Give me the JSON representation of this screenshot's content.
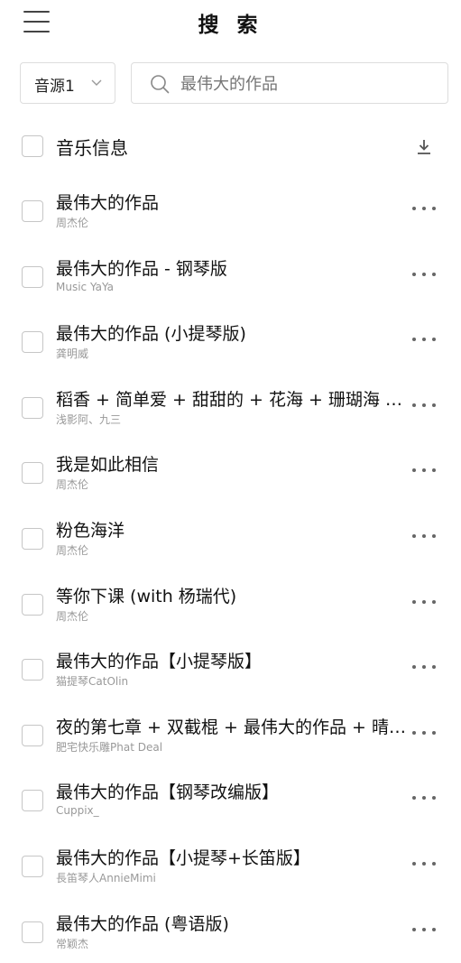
{
  "header": {
    "title": "搜 索",
    "menu_icon": "hamburger-menu-icon"
  },
  "search": {
    "source_label": "音源1",
    "placeholder": "最伟大的作品",
    "value": ""
  },
  "list_header": {
    "label": "音乐信息",
    "action_icon": "download-icon"
  },
  "songs": [
    {
      "title": "最伟大的作品",
      "artist": "周杰伦"
    },
    {
      "title": "最伟大的作品 - 钢琴版",
      "artist": "Music YaYa"
    },
    {
      "title": "最伟大的作品 (小提琴版)",
      "artist": "龚明威"
    },
    {
      "title": "稻香 + 简单爱 + 甜甜的 + 花海 + 珊瑚海 + …",
      "artist": "浅影阿、九三"
    },
    {
      "title": "我是如此相信",
      "artist": "周杰伦"
    },
    {
      "title": "粉色海洋",
      "artist": "周杰伦"
    },
    {
      "title": "等你下课 (with 杨瑞代)",
      "artist": "周杰伦"
    },
    {
      "title": "最伟大的作品【小提琴版】",
      "artist": "猫提琴CatOlin"
    },
    {
      "title": "夜的第七章 + 双截棍 + 最伟大的作品 + 晴…",
      "artist": "肥宅快乐雕Phat Deal"
    },
    {
      "title": "最伟大的作品【钢琴改编版】",
      "artist": "Cuppix_"
    },
    {
      "title": "最伟大的作品【小提琴+长笛版】",
      "artist": "長笛琴人AnnieMimi"
    },
    {
      "title": "最伟大的作品 (粤语版)",
      "artist": "常颖杰"
    }
  ]
}
